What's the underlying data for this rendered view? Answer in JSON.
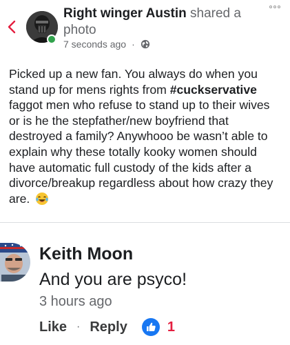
{
  "post": {
    "author": "Right winger Austin",
    "action": "shared a photo",
    "timestamp": "7 seconds ago",
    "meta_separator": "·",
    "privacy_icon": "globe-icon",
    "body_before_hashtag": "Picked up a new fan. You always do when you stand up for mens rights from ",
    "hashtag": "#cuckservative",
    "body_after_hashtag": " faggot men who refuse to stand up to their wives or is he the stepfather/new boyfriend that destroyed a family?  Anywhooo be wasn’t  able to explain why these totally kooky women should have automatic full custody of the kids after a divorce/breakup regardless about how crazy they are.",
    "emoji": "laughing-tears-emoji"
  },
  "comment": {
    "author": "Keith Moon",
    "text": "And you are psyco!",
    "timestamp": "3 hours ago",
    "like_label": "Like",
    "separator": "·",
    "reply_label": "Reply",
    "reaction_count": "1"
  },
  "colors": {
    "accent": "#1877f2",
    "online": "#31a24c",
    "reaction_count": "#e41e3f",
    "back_chevron": "#e41e3f"
  }
}
